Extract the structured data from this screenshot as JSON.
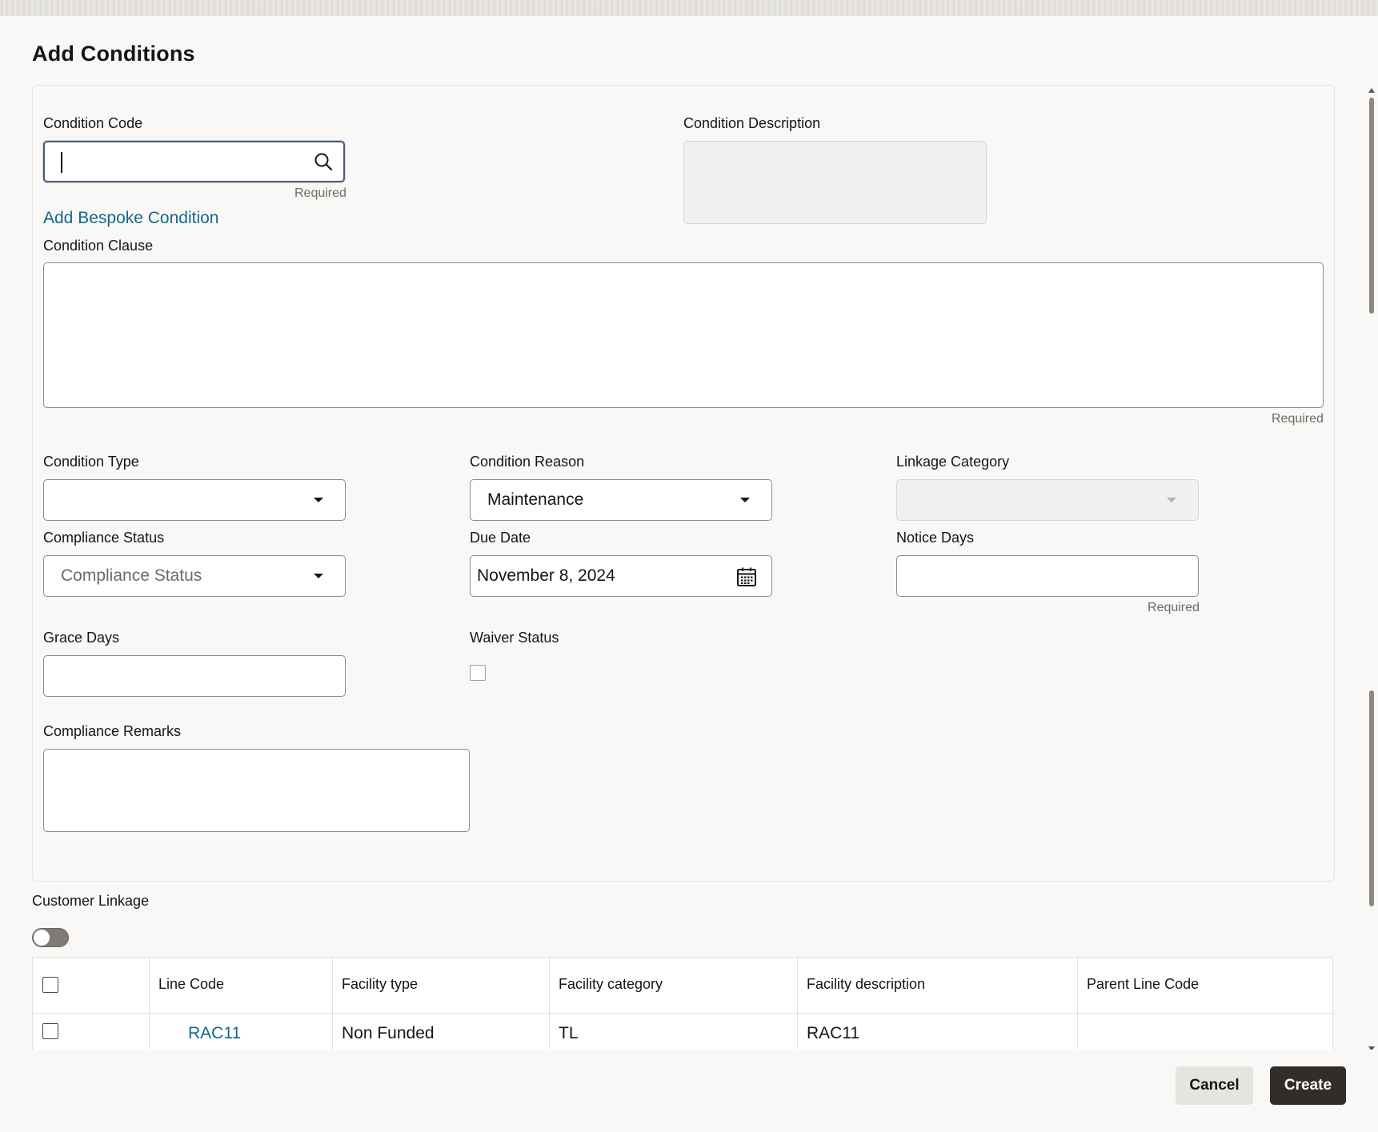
{
  "dialog": {
    "title": "Add Conditions"
  },
  "condition_code": {
    "label": "Condition Code",
    "value": "",
    "help": "Required",
    "icon": "search-icon"
  },
  "condition_description": {
    "label": "Condition Description",
    "value": ""
  },
  "bespoke_link": {
    "label": "Add Bespoke Condition"
  },
  "condition_clause": {
    "label": "Condition Clause",
    "value": "",
    "help": "Required"
  },
  "condition_type": {
    "label": "Condition Type",
    "value": ""
  },
  "condition_reason": {
    "label": "Condition Reason",
    "value": "Maintenance"
  },
  "linkage_category": {
    "label": "Linkage Category",
    "value": ""
  },
  "compliance_status": {
    "label": "Compliance Status",
    "placeholder": "Compliance Status"
  },
  "due_date": {
    "label": "Due Date",
    "value": "November 8, 2024",
    "icon": "calendar-icon"
  },
  "notice_days": {
    "label": "Notice Days",
    "value": "",
    "help": "Required"
  },
  "grace_days": {
    "label": "Grace Days",
    "value": ""
  },
  "waiver_status": {
    "label": "Waiver Status",
    "checked": false
  },
  "compliance_remarks": {
    "label": "Compliance Remarks",
    "value": ""
  },
  "customer_linkage": {
    "label": "Customer Linkage",
    "enabled": false
  },
  "table": {
    "columns": [
      "Line Code",
      "Facility type",
      "Facility category",
      "Facility description",
      "Parent Line Code"
    ],
    "rows": [
      {
        "line_code": "RAC11",
        "facility_type": "Non Funded",
        "facility_category": "TL",
        "facility_description": "RAC11",
        "parent_line_code": ""
      }
    ]
  },
  "footer": {
    "cancel": "Cancel",
    "create": "Create"
  },
  "colors": {
    "link": "#0f6a8c",
    "primary_button": "#312d2a",
    "background": "#f9f8f6"
  }
}
